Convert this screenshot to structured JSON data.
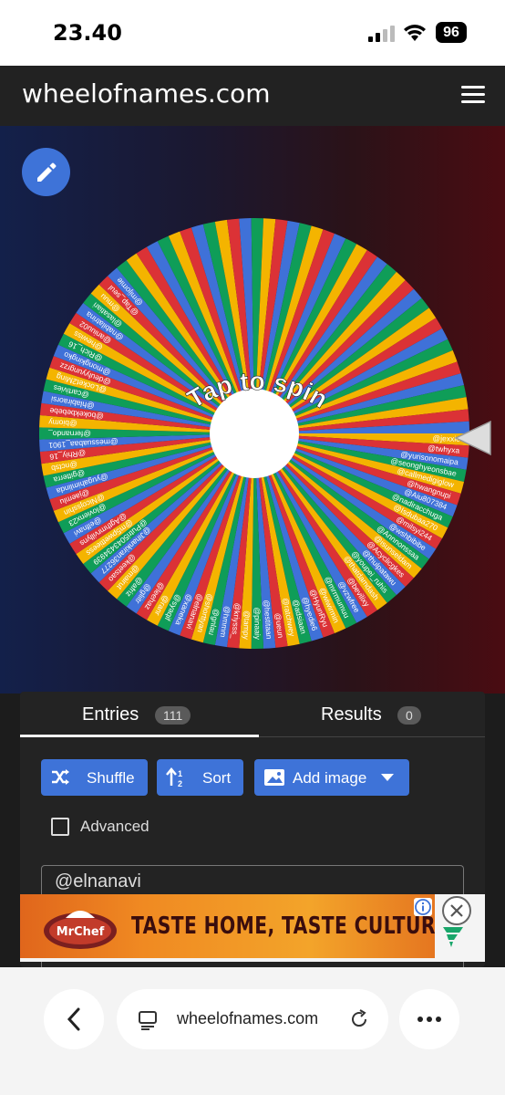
{
  "status_bar": {
    "time": "23.40",
    "battery": "96"
  },
  "header": {
    "title": "wheelofnames.com",
    "menu_icon": "hamburger-menu-icon"
  },
  "wheel": {
    "center_text": "Tap to spin",
    "colors": [
      "#f4b400",
      "#db3236",
      "#3f71d8",
      "#0f9d58"
    ],
    "segment_count": 111,
    "visible_labels": [
      "@jexxie",
      "@twhyxa",
      "@yurisonomaipa",
      "@seonghyeonsbae",
      "@callmedigiglow",
      "@hwangnupi",
      "@Aiu807384",
      "@nadiracchuga",
      "@Isdubaa270",
      "@milsyi244",
      "@wshbibibe",
      "@Annnonssaa",
      "@isunseldam",
      "@Acyclicgkes",
      "@thulpatawu",
      "@youpei_ruhis",
      "@thatdamdash",
      "@bevilixy",
      "@vzwfree",
      "@mrrmumuu",
      "@wiwirmin",
      "@HyunRyu",
      "@hyedie6",
      "@adsiaan",
      "@ratchwey",
      "@ueun",
      "@hestitaan",
      "@pinaaiy",
      "@tampy",
      "@kriysss_",
      "@hmmm",
      "@gnlau",
      "@shorttyan",
      "@elnanavi",
      "@xaneka",
      "@syaqif",
      "@ranr",
      "@leehaz",
      "@gliitr",
      "@afriz",
      "@mairut",
      "@keetsao",
      "@Jihankiran36277",
      "@Putri5043434939",
      "@m5pwettieess",
      "@Agthmrvillyns",
      "@elfnavi",
      "@lovienx23",
      "@Nicojsshin",
      "@jaemlu",
      "@yugahimlinda",
      "@gitterra",
      "@nctsb",
      "@Rhiy_16",
      "@messuabaa_1901",
      "@fernando_",
      "@biomy",
      "@bokekbebebe",
      "@hlabiraorsi",
      "@cartivies",
      "@Locket2Ming",
      "@deulyyungrzz",
      "@mongkingko",
      "@Rich_16",
      "@hewiss",
      "@aniuu02",
      "@nabilatrina",
      "@lasatiari",
      "@muu",
      "@Tap_seul",
      "@mijomie"
    ]
  },
  "panel": {
    "tabs": [
      {
        "label": "Entries",
        "count": "111"
      },
      {
        "label": "Results",
        "count": "0"
      }
    ],
    "buttons": {
      "shuffle": "Shuffle",
      "sort": "Sort",
      "add_image": "Add image"
    },
    "advanced_label": "Advanced",
    "entries_text": "@elnanavi"
  },
  "ad": {
    "text": "TASTE HOME, TASTE CULTURE!",
    "logo_text": "MrChef"
  },
  "browser": {
    "url": "wheelofnames.com"
  }
}
